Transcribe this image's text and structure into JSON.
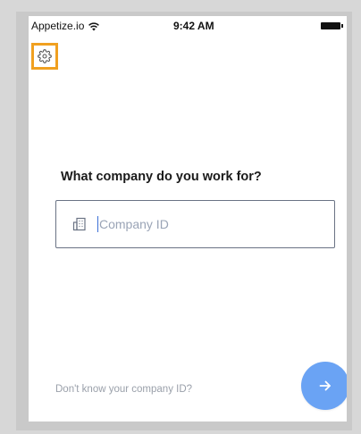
{
  "status_bar": {
    "carrier": "Appetize.io",
    "time": "9:42 AM",
    "wifi_icon": "wifi-icon",
    "battery_icon": "battery-full-icon"
  },
  "toolbar": {
    "settings_icon": "gear-icon",
    "highlight_color": "#f0a020"
  },
  "main": {
    "title": "What company do you work for?",
    "company_field": {
      "icon": "building-icon",
      "placeholder": "Company ID",
      "value": ""
    }
  },
  "footer": {
    "help_link": "Don't know your company ID?",
    "next_icon": "arrow-right-icon",
    "next_color": "#6aa3f4"
  }
}
